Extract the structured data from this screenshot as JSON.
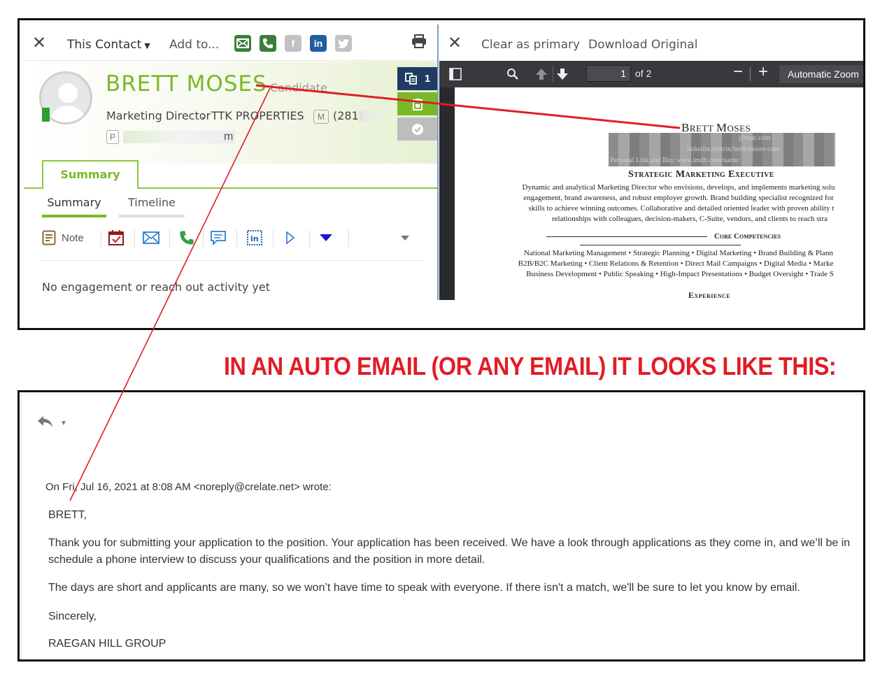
{
  "crm": {
    "toolbar": {
      "this_contact_label": "This Contact",
      "add_to_label": "Add to..."
    },
    "contact": {
      "name": "BRETT MOSES",
      "type": "Candidate",
      "title": "Marketing Director",
      "company": "TTK PROPERTIES",
      "phone_badge": "M",
      "phone": "(281)",
      "email_badge": "P",
      "email_visible_tail": "m"
    },
    "side_buttons": {
      "documents_count": "1"
    },
    "tabs": {
      "main_tab": "Summary",
      "subtab_summary": "Summary",
      "subtab_timeline": "Timeline"
    },
    "actions": {
      "note_label": "Note"
    },
    "empty_message": "No engagement or reach out activity yet"
  },
  "pdf_viewer": {
    "clear_primary_label": "Clear as primary",
    "download_label": "Download Original",
    "current_page": "1",
    "page_of": "of 2",
    "zoom_label": "Automatic Zoom",
    "resume": {
      "name": "Brett Moses",
      "contact_line_1": "@mac.com",
      "contact_line_2": "linkedin.com/in/brett-moses-cmo",
      "contact_line_3": "Personal Link and Bio: www.imdb.com/name/",
      "heading": "Strategic Marketing Executive",
      "summary_lines": [
        "Dynamic and analytical Marketing Director who envisions, develops, and implements marketing solu",
        "engagement, brand awareness, and robust employer growth. Brand building specialist recognized for",
        "skills to achieve winning outcomes. Collaborative and detailed oriented leader with proven ability t",
        "relationships with colleagues, decision-makers, C-Suite, vendors, and clients to reach stra"
      ],
      "core_competencies_heading": "Core Competencies",
      "competency_lines": [
        "National Marketing Management • Strategic Planning • Digital Marketing • Brand Building & Plann",
        "B2B/B2C Marketing • Client Relations & Retention • Direct Mail Campaigns • Digital Media • Marke",
        "Business Development • Public Speaking • High-Impact Presentations • Budget Oversight • Trade S"
      ],
      "experience_heading": "Experience"
    }
  },
  "annotation": {
    "headline": "IN AN AUTO EMAIL (OR ANY EMAIL) IT LOOKS LIKE THIS:",
    "line_color": "#e11d25"
  },
  "email": {
    "quote_header": "On Fri, Jul 16, 2021 at 8:08 AM <noreply@crelate.net> wrote:",
    "greeting": "BRETT,",
    "paragraph_1_line_1": "Thank you for submitting your application to the position. Your application has been received. We have a look through applications as they come in, and we’ll be in",
    "paragraph_1_line_2": "schedule a phone interview to discuss your qualifications and the position in more detail.",
    "paragraph_2": "The days are short and applicants are many, so we won’t have time to speak with everyone. If there isn't a match, we'll be sure to let you know by email.",
    "closing": "Sincerely,",
    "signature": "RAEGAN HILL GROUP"
  },
  "colors": {
    "accent_green": "#79b928",
    "email_icon_green": "#3b7d3b",
    "doc_button_navy": "#1f3b63",
    "pdf_toolbar": "#38383d"
  }
}
